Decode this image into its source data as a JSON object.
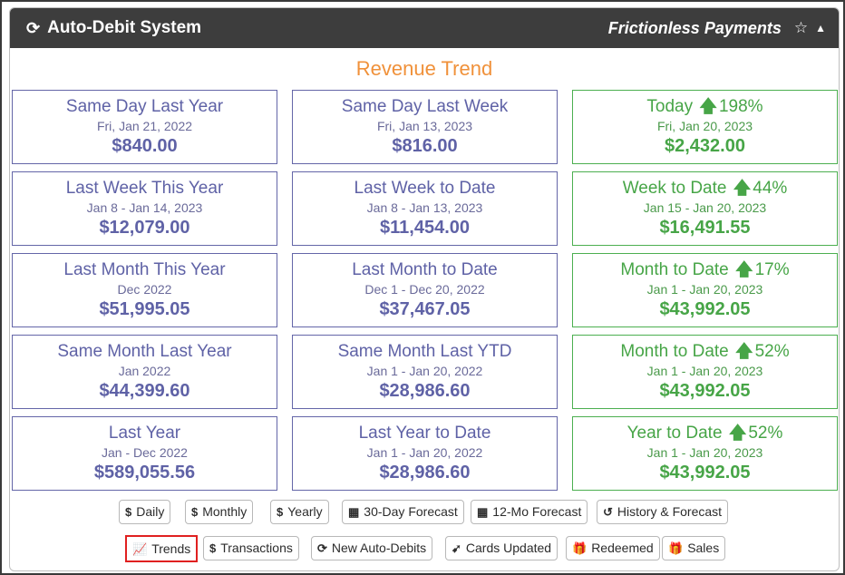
{
  "header": {
    "title": "Auto-Debit System",
    "right_text": "Frictionless Payments"
  },
  "section_title": "Revenue Trend",
  "colors": {
    "blue": "#5f62a6",
    "green": "#47a547",
    "orange": "#f0913a",
    "header_bg": "#3d3d3d",
    "selected_border": "#e02020"
  },
  "cards": [
    {
      "label": "Same Day Last Year",
      "date": "Fri, Jan 21, 2022",
      "value": "$840.00"
    },
    {
      "label": "Same Day Last Week",
      "date": "Fri, Jan 13, 2023",
      "value": "$816.00"
    },
    {
      "label": "Today",
      "change": "198%",
      "date": "Fri, Jan 20, 2023",
      "value": "$2,432.00"
    },
    {
      "label": "Last Week This Year",
      "date": "Jan 8 - Jan 14, 2023",
      "value": "$12,079.00"
    },
    {
      "label": "Last Week to Date",
      "date": "Jan 8 - Jan 13, 2023",
      "value": "$11,454.00"
    },
    {
      "label": "Week to Date",
      "change": "44%",
      "date": "Jan 15 - Jan 20, 2023",
      "value": "$16,491.55"
    },
    {
      "label": "Last Month This Year",
      "date": "Dec 2022",
      "value": "$51,995.05"
    },
    {
      "label": "Last Month to Date",
      "date": "Dec 1 - Dec 20, 2022",
      "value": "$37,467.05"
    },
    {
      "label": "Month to Date",
      "change": "17%",
      "date": "Jan 1 - Jan 20, 2023",
      "value": "$43,992.05"
    },
    {
      "label": "Same Month Last Year",
      "date": "Jan 2022",
      "value": "$44,399.60"
    },
    {
      "label": "Same Month Last YTD",
      "date": "Jan 1 - Jan 20, 2022",
      "value": "$28,986.60"
    },
    {
      "label": "Month to Date",
      "change": "52%",
      "date": "Jan 1 - Jan 20, 2023",
      "value": "$43,992.05"
    },
    {
      "label": "Last Year",
      "date": "Jan - Dec 2022",
      "value": "$589,055.56"
    },
    {
      "label": "Last Year to Date",
      "date": "Jan 1 - Jan 20, 2022",
      "value": "$28,986.60"
    },
    {
      "label": "Year to Date",
      "change": "52%",
      "date": "Jan 1 - Jan 20, 2023",
      "value": "$43,992.05"
    }
  ],
  "buttons_row1": [
    {
      "label": "Daily",
      "icon": "dollar-icon"
    },
    {
      "label": "Monthly",
      "icon": "dollar-icon"
    },
    {
      "label": "Yearly",
      "icon": "dollar-icon"
    },
    {
      "label": "30-Day Forecast",
      "icon": "calendar-icon"
    },
    {
      "label": "12-Mo Forecast",
      "icon": "calendar-icon"
    },
    {
      "label": "History & Forecast",
      "icon": "history-icon"
    }
  ],
  "buttons_row2": [
    {
      "label": "Trends",
      "icon": "line-chart-icon",
      "selected": true
    },
    {
      "label": "Transactions",
      "icon": "dollar-icon"
    },
    {
      "label": "New Auto-Debits",
      "icon": "refresh-icon"
    },
    {
      "label": "Cards Updated",
      "icon": "rocket-icon"
    },
    {
      "label": "Redeemed",
      "icon": "gift-icon"
    },
    {
      "label": "Sales",
      "icon": "gift-icon"
    }
  ]
}
